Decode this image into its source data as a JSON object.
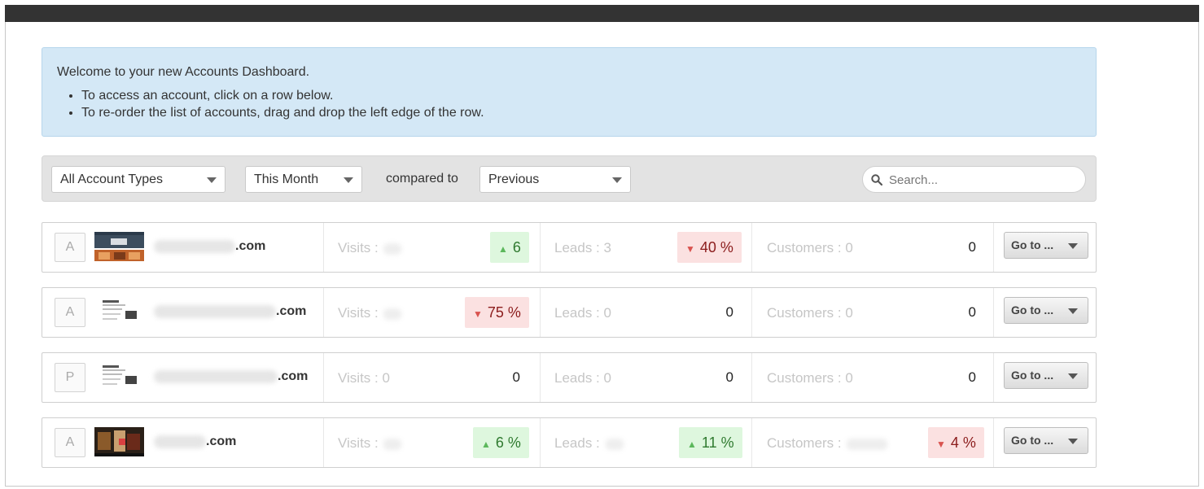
{
  "welcome": {
    "title": "Welcome to your new Accounts Dashboard.",
    "bullets": [
      "To access an account, click on a row below.",
      "To re-order the list of accounts, drag and drop the left edge of the row."
    ]
  },
  "filters": {
    "account_type": "All Account Types",
    "period": "This Month",
    "compared_label": "compared to",
    "comparison": "Previous",
    "search_placeholder": "Search..."
  },
  "rows": [
    {
      "badge": "A",
      "domain_suffix": ".com",
      "visits_label": "Visits : ",
      "visits_delta": "6",
      "visits_trend": "up",
      "leads_label": "Leads : 3",
      "leads_delta": "40 %",
      "leads_trend": "down",
      "customers_label": "Customers : 0",
      "customers_value": "0",
      "goto": "Go to ..."
    },
    {
      "badge": "A",
      "domain_suffix": ".com",
      "visits_label": "Visits : ",
      "visits_delta": "75 %",
      "visits_trend": "down",
      "leads_label": "Leads : 0",
      "leads_value": "0",
      "customers_label": "Customers : 0",
      "customers_value": "0",
      "goto": "Go to ..."
    },
    {
      "badge": "P",
      "domain_suffix": ".com",
      "visits_label": "Visits : 0",
      "visits_value": "0",
      "leads_label": "Leads : 0",
      "leads_value": "0",
      "customers_label": "Customers : 0",
      "customers_value": "0",
      "goto": "Go to ..."
    },
    {
      "badge": "A",
      "domain_suffix": ".com",
      "visits_label": "Visits : ",
      "visits_delta": "6 %",
      "visits_trend": "up",
      "leads_label": "Leads : ",
      "leads_delta": "11 %",
      "leads_trend": "up",
      "customers_label": "Customers : ",
      "customers_delta": "4 %",
      "customers_trend": "down",
      "goto": "Go to ..."
    }
  ],
  "icons": {
    "search": "search-icon",
    "dropdown": "chevron-down-icon",
    "up": "arrow-up-icon",
    "down": "arrow-down-icon"
  },
  "colors": {
    "welcome_bg": "#d4e8f6",
    "up_bg": "#def7de",
    "down_bg": "#fbe1e1",
    "topbar": "#333333"
  }
}
